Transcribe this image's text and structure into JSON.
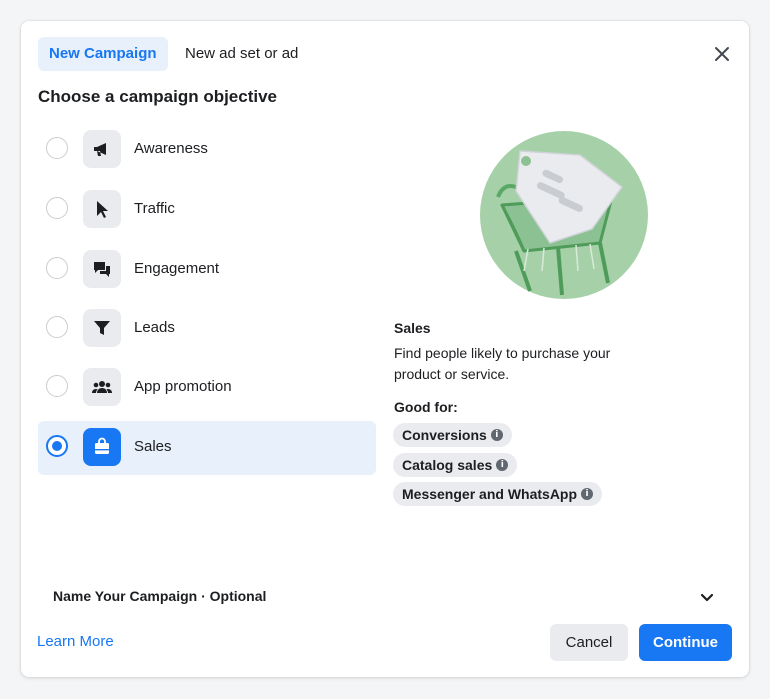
{
  "tabs": [
    {
      "label": "New Campaign",
      "active": true
    },
    {
      "label": "New ad set or ad",
      "active": false
    }
  ],
  "heading": "Choose a campaign objective",
  "objectives": [
    {
      "label": "Awareness",
      "icon": "megaphone-icon",
      "selected": false
    },
    {
      "label": "Traffic",
      "icon": "cursor-icon",
      "selected": false
    },
    {
      "label": "Engagement",
      "icon": "chat-bubbles-icon",
      "selected": false
    },
    {
      "label": "Leads",
      "icon": "funnel-icon",
      "selected": false
    },
    {
      "label": "App promotion",
      "icon": "people-icon",
      "selected": false
    },
    {
      "label": "Sales",
      "icon": "shopping-bag-icon",
      "selected": true
    }
  ],
  "detail": {
    "illustration": "shopping-cart-tag-illustration",
    "title": "Sales",
    "description": "Find people likely to purchase your product or service.",
    "good_for_label": "Good for:",
    "good_for": [
      "Conversions",
      "Catalog sales",
      "Messenger and WhatsApp"
    ]
  },
  "name_section": {
    "label": "Name Your Campaign · Optional"
  },
  "footer": {
    "learn_more": "Learn More",
    "cancel": "Cancel",
    "continue": "Continue"
  },
  "colors": {
    "accent": "#1877f2",
    "selected_bg": "#e7f0fb",
    "illustration_green": "#8cc293"
  }
}
